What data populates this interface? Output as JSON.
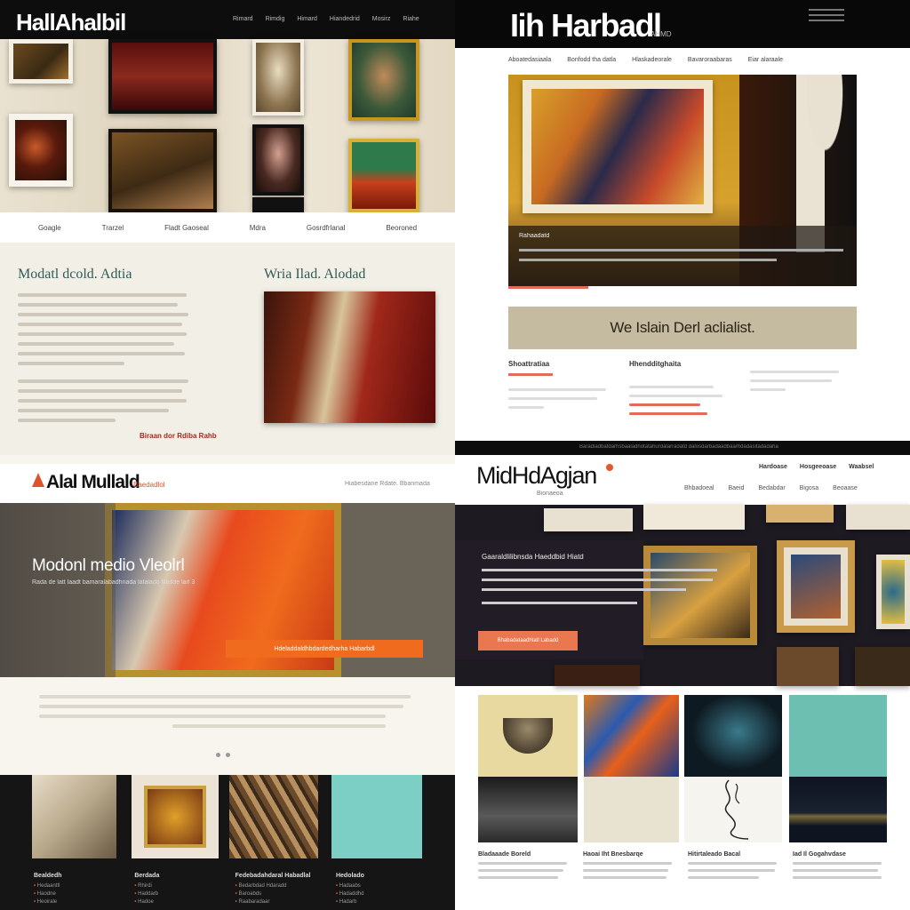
{
  "q1": {
    "logo": "HallAhalbil",
    "top_nav": [
      "Rimard",
      "Rimdig",
      "Himard",
      "Hiandedrid",
      "Mosirz",
      "Riahe"
    ],
    "categories": [
      "Goagle",
      "Trarzel",
      "Fladt Gaoseal",
      "Mdra",
      "Gosrdfrlanal",
      "Beoroned"
    ],
    "heading_left": "Modatl dcold. Adtia",
    "heading_right": "Wria Ilad. Alodad",
    "cta": "Biraan dor Rdiba Rahb"
  },
  "q2": {
    "logo": "Iih Harbadl",
    "logo_sub": "AHMD",
    "nav": [
      "Aboatedasiaala",
      "Bonfodd tha datla",
      "Hlaskadeorale",
      "Bavaroraabaras",
      "Eiar alaraale"
    ],
    "feature_caption": "Rahaadatd",
    "banner": "We Islain Derl aclialist.",
    "columns": [
      {
        "title": "Shoattratiaa"
      },
      {
        "title": "Hhendditghaita"
      },
      {
        "title": ""
      }
    ]
  },
  "strip": {
    "text": "Baradladbatdarhsbaaladhotatahurdalarradatd dalosdarbadaadbaarhdadasltadadaha"
  },
  "q3": {
    "logo": "Alal Mullald",
    "logo_tag": "Baedadlol",
    "top_links": "Hiabesdane Rdate. Bbanmada",
    "hero_title": "Modonl medio Vleolrl",
    "hero_sub": "Rada de latt laadt bamaralabadhnada lafalado fliadde larl 3",
    "hero_button": "Hdeladdaldhbdardedharha Habarbdl",
    "footer_cols": [
      {
        "title": "Bealdedh",
        "items": [
          "Hedaanttl",
          "Haodne",
          "Heoirale"
        ]
      },
      {
        "title": "Berdada",
        "items": [
          "Rhirdi",
          "Haddarb",
          "Hadoe"
        ]
      },
      {
        "title": "Fedebadahdaral Habadlal",
        "items": [
          "Bedarbdad Hdaradd",
          "Baroabds",
          "Raabaradaar"
        ]
      },
      {
        "title": "Hedolado",
        "items": [
          "Hadaabs",
          "Hadaddhd",
          "Hadarb"
        ]
      }
    ]
  },
  "q4": {
    "logo": "MidHdAgjan",
    "logo_tag": "Bionaeoa",
    "top_nav": [
      "Hardoase",
      "Hosgeeoase",
      "Waabsel"
    ],
    "sub_nav": [
      "Bhbadoeal",
      "Baeid",
      "Bedabdar",
      "Bigosa",
      "Beoaase"
    ],
    "overlay_title": "Gaaraldlilibnsda Haeddbid Hiatd",
    "overlay_button": "Bhabadataadhtatl Labadd",
    "cards": [
      {
        "title": "Bladaaade Boreld"
      },
      {
        "title": "Haoai Iht Bnesbarqe"
      },
      {
        "title": "Hitirtaleado Bacal"
      },
      {
        "title": "Iad Il Gogahvdase"
      }
    ]
  },
  "colors": {
    "q1_heading": "#2f5b58",
    "q1_cta": "#a12d1e",
    "q3_accent": "#f06b1d",
    "q4_accent": "#e05a2f",
    "q2_banner": "#c5bba0"
  }
}
